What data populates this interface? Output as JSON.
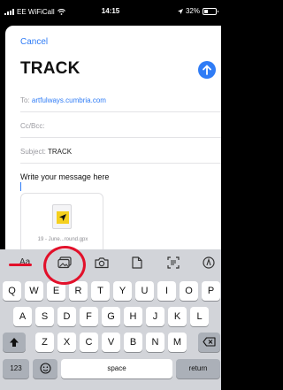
{
  "status": {
    "carrier": "EE WiFiCall",
    "time": "14:15",
    "battery": "32%"
  },
  "compose": {
    "cancel": "Cancel",
    "title": "TRACK",
    "to_label": "To:",
    "to_value": "artfulways.cumbria.com",
    "cc_label": "Cc/Bcc:",
    "subject_label": "Subject:",
    "subject_value": "TRACK",
    "body": "Write your message here"
  },
  "attachment": {
    "name": "19 - June...round.gpx",
    "icon": "gpx-file-icon"
  },
  "keyboard": {
    "toolbar": {
      "aa": "Aa",
      "icons": [
        "photo-library-icon",
        "camera-icon",
        "document-icon",
        "scan-icon",
        "markup-icon"
      ]
    },
    "row1": [
      "Q",
      "W",
      "E",
      "R",
      "T",
      "Y",
      "U",
      "I",
      "O",
      "P"
    ],
    "row2": [
      "A",
      "S",
      "D",
      "F",
      "G",
      "H",
      "J",
      "K",
      "L"
    ],
    "row3": [
      "Z",
      "X",
      "C",
      "V",
      "B",
      "N",
      "M"
    ],
    "numbers": "123",
    "space": "space",
    "return": "return"
  },
  "annotation": {
    "color": "#e2102a"
  }
}
